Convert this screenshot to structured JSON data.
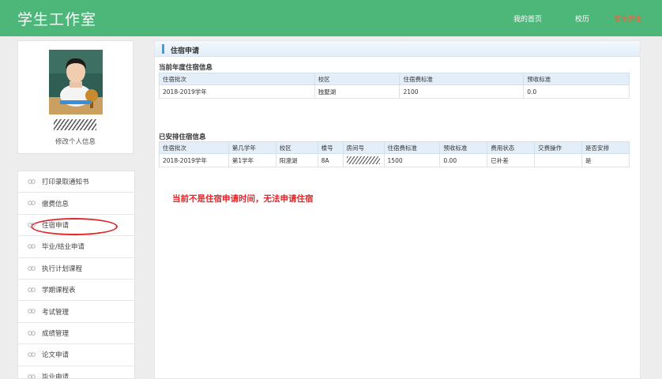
{
  "app": {
    "title": "学生工作室"
  },
  "nav": {
    "home": "我的首页",
    "calendar": "校历",
    "logout": "安全退出"
  },
  "profile": {
    "edit_label": "修改个人信息"
  },
  "sidebar": {
    "items": [
      {
        "label": "打印录取通知书"
      },
      {
        "label": "缴费信息"
      },
      {
        "label": "住宿申请",
        "active": true
      },
      {
        "label": "毕业/结业申请"
      },
      {
        "label": "执行计划课程"
      },
      {
        "label": "学期课程表"
      },
      {
        "label": "考试管理"
      },
      {
        "label": "成绩管理"
      },
      {
        "label": "论文申请"
      },
      {
        "label": "毕业申请"
      }
    ]
  },
  "panel": {
    "title": "住宿申请"
  },
  "current_year": {
    "title": "当前年度住宿信息",
    "headers": [
      "住宿批次",
      "校区",
      "住宿费标准",
      "预收标准"
    ],
    "row": [
      "2018-2019学年",
      "独墅湖",
      "2100",
      "0.0"
    ]
  },
  "arranged": {
    "title": "已安排住宿信息",
    "headers": [
      "住宿批次",
      "第几学年",
      "校区",
      "楼号",
      "房间号",
      "住宿费标准",
      "预收标准",
      "费用状态",
      "交费操作",
      "是否安排"
    ],
    "row": [
      "2018-2019学年",
      "第1学年",
      "阳澄湖",
      "8A",
      "",
      "1500",
      "0.00",
      "已补差",
      "",
      "是"
    ]
  },
  "notice": "当前不是住宿申请时间，无法申请住宿",
  "colors": {
    "topbar": "#4db77a",
    "logout": "#ff5a36",
    "notice": "#e0262a",
    "table_header": "#e3eef9"
  }
}
